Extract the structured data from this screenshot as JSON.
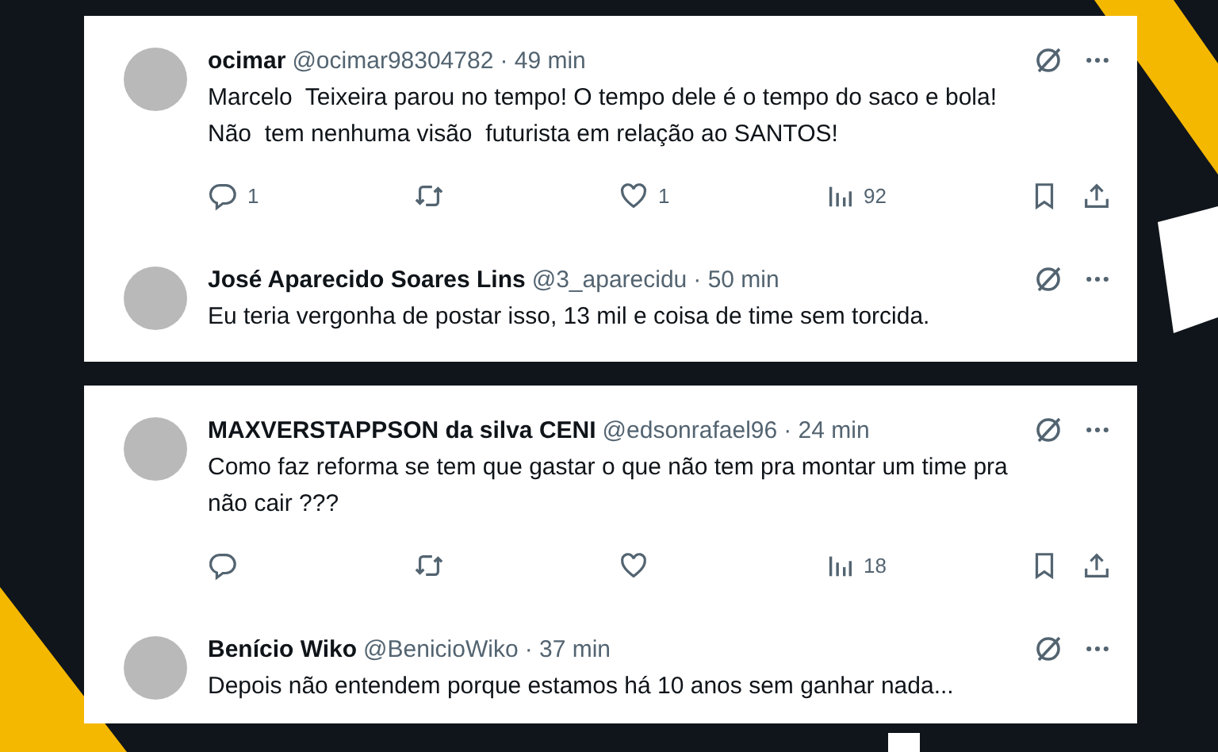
{
  "panels": [
    {
      "tweets": [
        {
          "name": "ocimar",
          "handle": "@ocimar98304782",
          "time": "· 49 min",
          "text": "Marcelo  Teixeira parou no tempo! O tempo dele é o tempo do saco e bola!\nNão  tem nenhuma visão  futurista em relação ao SANTOS!",
          "actions": {
            "replies": "1",
            "likes": "1",
            "views": "92"
          }
        },
        {
          "name": "José Aparecido Soares Lins",
          "handle": "@3_aparecidu",
          "time": "· 50 min",
          "text": "Eu teria vergonha de postar isso, 13 mil e coisa de time sem torcida."
        }
      ]
    },
    {
      "tweets": [
        {
          "name": "MAXVERSTAPPSON da silva CENI",
          "handle": "@edsonrafael96",
          "time": "· 24 min",
          "text": "Como faz reforma se tem que gastar o que não tem pra montar um time pra\nnão cair ???",
          "actions": {
            "views": "18"
          }
        },
        {
          "name": "Benício Wiko",
          "handle": "@BenicioWiko",
          "time": "· 37 min",
          "text": "Depois não entendem porque estamos há 10 anos sem ganhar nada..."
        }
      ]
    }
  ]
}
